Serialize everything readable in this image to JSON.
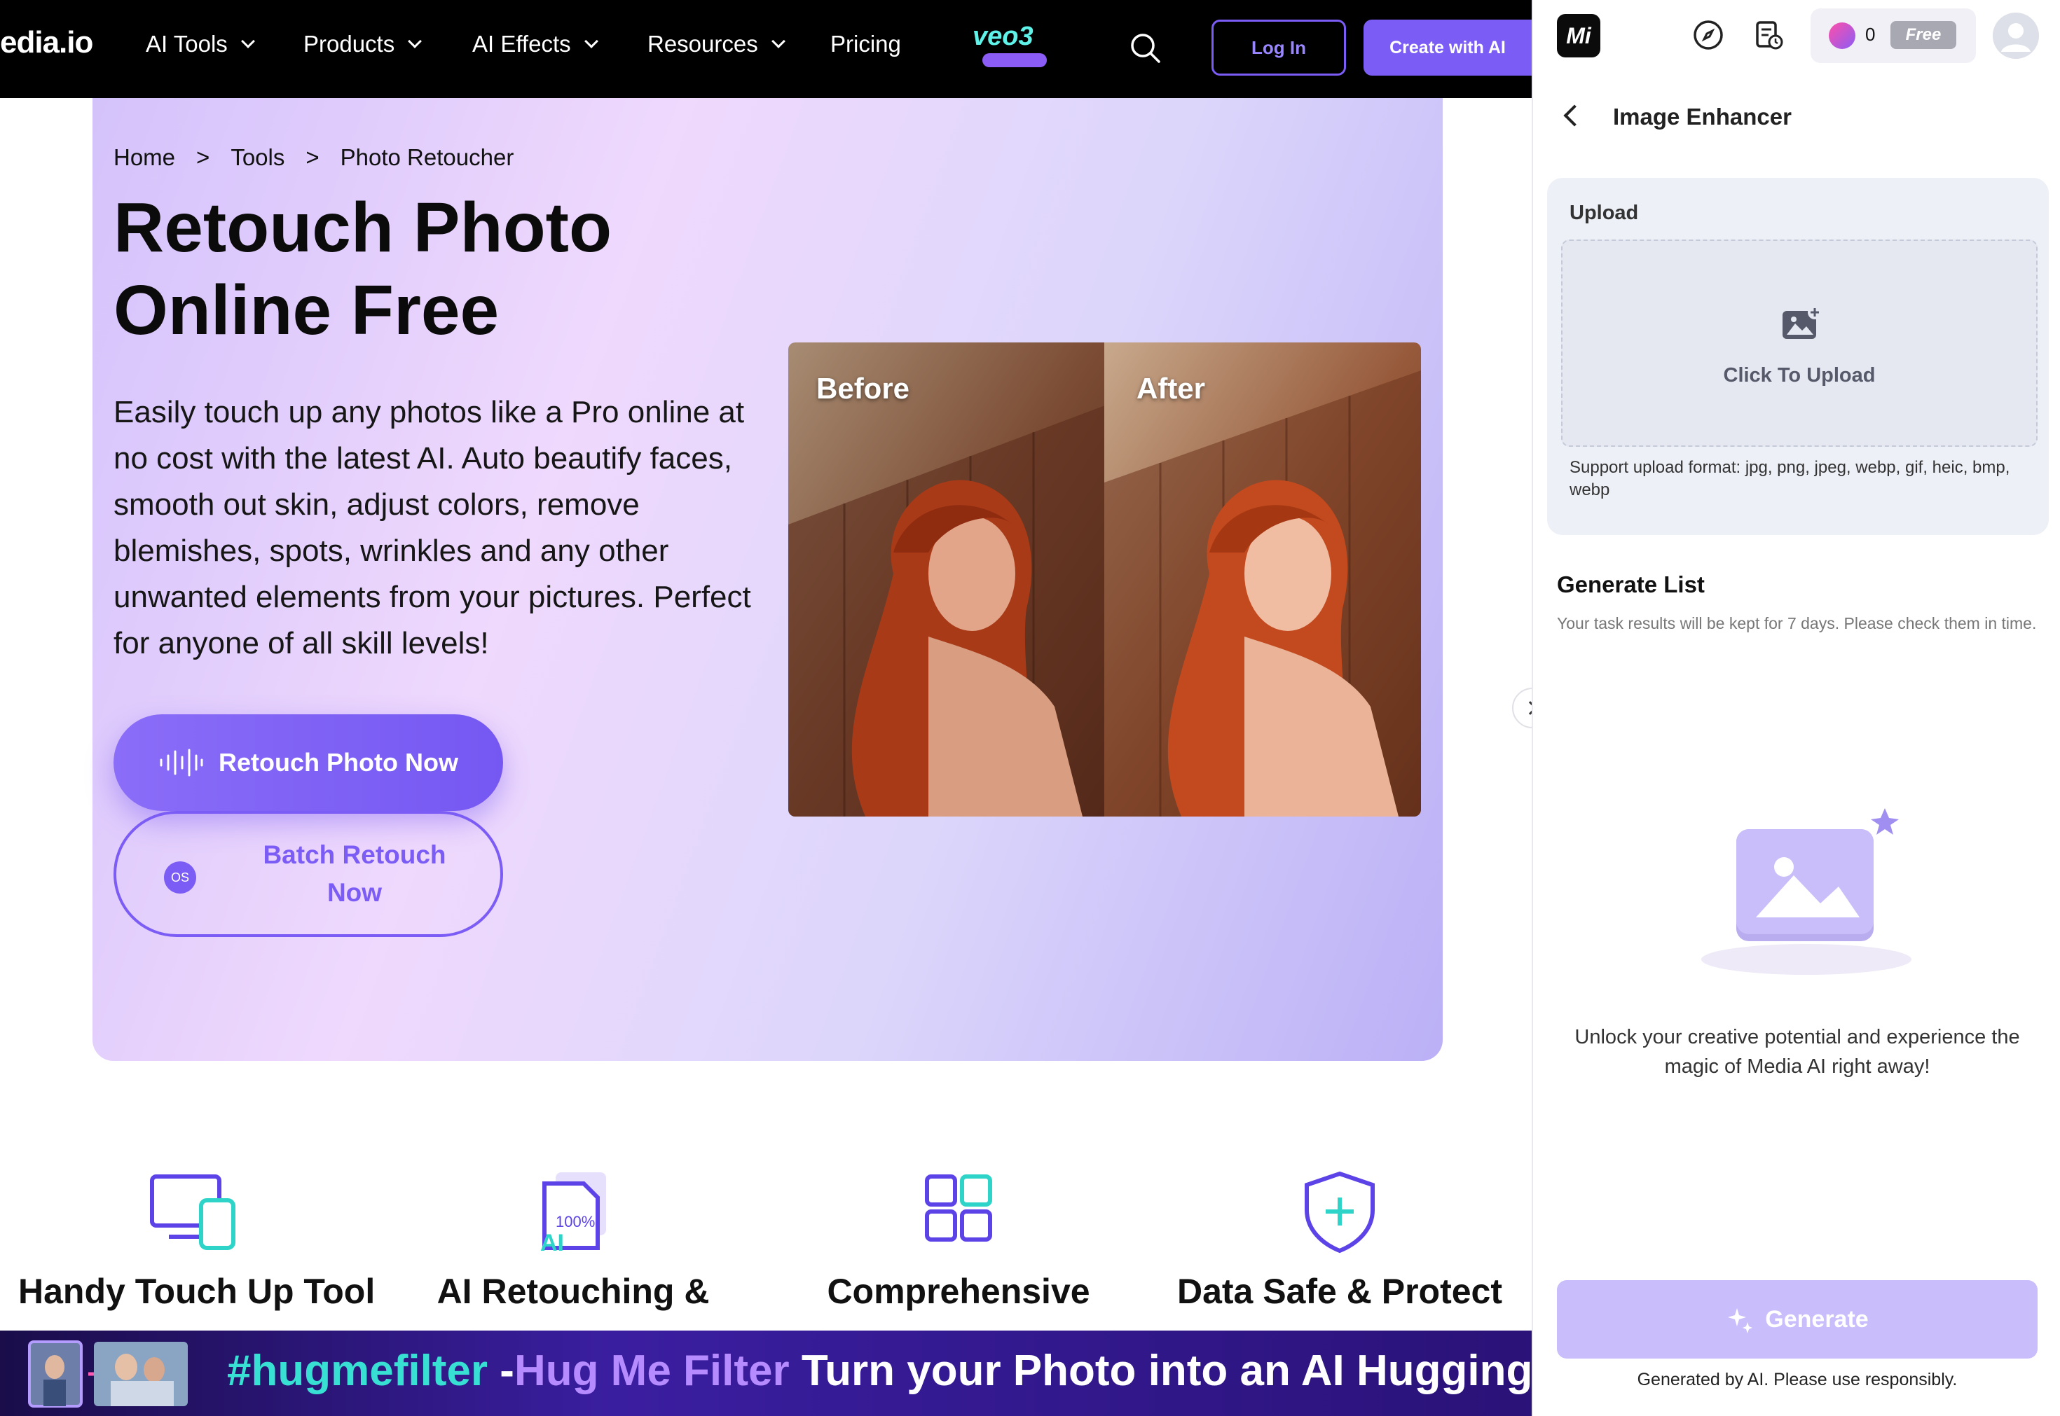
{
  "nav": {
    "logo": "edia.io",
    "items": [
      {
        "label": "AI Tools"
      },
      {
        "label": "Products"
      },
      {
        "label": "AI Effects"
      },
      {
        "label": "Resources"
      },
      {
        "label": "Pricing"
      }
    ],
    "login_label": "Log In",
    "create_label": "Create with AI",
    "veo_badge": "veo3",
    "search_icon": "search-icon"
  },
  "hero": {
    "breadcrumb": [
      "Home",
      ">",
      "Tools",
      ">",
      "Photo Retoucher"
    ],
    "title_line1": "Retouch Photo",
    "title_line2": "Online Free",
    "description": "Easily touch up any photos like a Pro online at no cost with the latest AI. Auto beautify faces, smooth out skin, adjust colors, remove blemishes, spots, wrinkles and any other unwanted elements from your pictures. Perfect for anyone of all skill levels!",
    "primary_button": "Retouch Photo Now",
    "secondary_button": "Batch Retouch Now",
    "os_badge": "OS",
    "before_label": "Before",
    "after_label": "After"
  },
  "features": [
    {
      "title": "Handy Touch Up Tool",
      "icon": "devices-icon"
    },
    {
      "title": "AI Retouching &",
      "icon": "ai-document-icon"
    },
    {
      "title": "Comprehensive",
      "icon": "grid-icon"
    },
    {
      "title": "Data Safe & Protect",
      "icon": "shield-plus-icon"
    }
  ],
  "banner": {
    "hashtag": "#hugmefilter",
    "dash": " -",
    "highlight": "Hug Me Filter",
    "rest": " Turn your Photo into an AI Hugging Vic"
  },
  "panel": {
    "credits": "0",
    "plan_badge": "Free",
    "title": "Image Enhancer",
    "upload_label": "Upload",
    "upload_cta": "Click To Upload",
    "formats": "Support upload format: jpg, png, jpeg, webp, gif, heic, bmp, webp",
    "generate_list_title": "Generate List",
    "generate_list_note": "Your task results will be kept for 7 days. Please check them in time.",
    "empty_message": "Unlock your creative potential and experience the magic of Media AI right away!",
    "generate_button": "Generate",
    "disclaimer": "Generated by AI. Please use responsibly."
  },
  "colors": {
    "accent": "#7b5cf5",
    "nav_bg": "#000000",
    "hero_gradient_start": "#d4c2fb",
    "generate_disabled": "#c9bdfb"
  }
}
